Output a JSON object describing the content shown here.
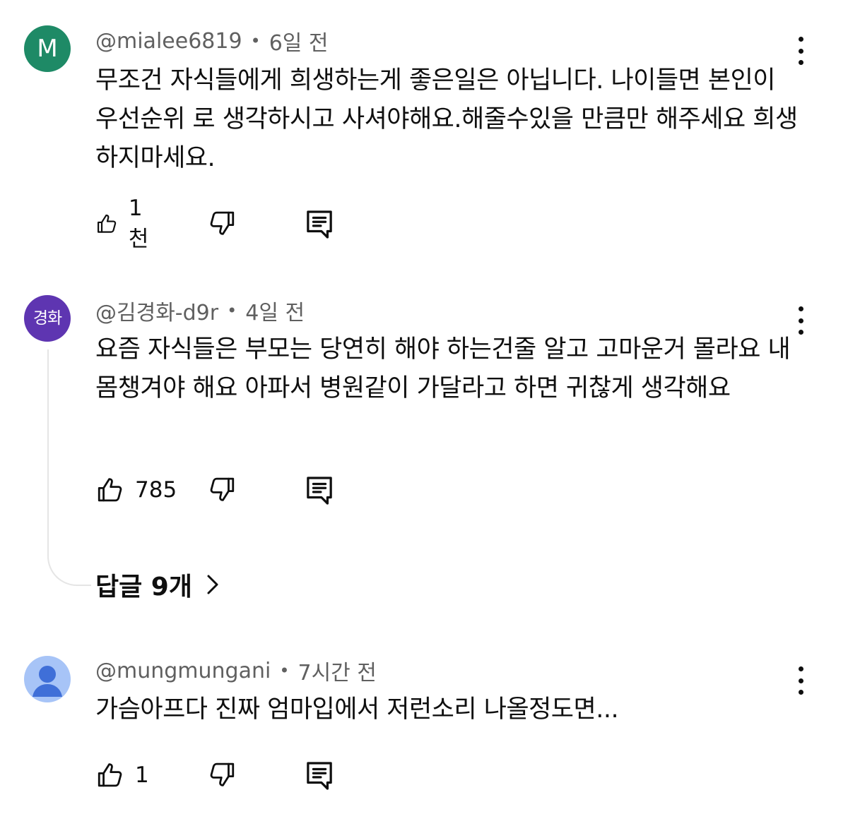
{
  "comments": [
    {
      "avatar": {
        "type": "letter",
        "text": "M",
        "color": "#1e8a66"
      },
      "handle": "@mialee6819",
      "time": "6일 전",
      "text": "무조건 자식들에게 희생하는게 좋은일은 아닙니다. 나이들면 본인이 우선순위 로 생각하시고 사셔야해요.해줄수있을 만큼만 해주세요 희생하지마세요.",
      "likes": "1천"
    },
    {
      "avatar": {
        "type": "text",
        "text": "경화",
        "color": "#5e35b1"
      },
      "handle": "@김경화-d9r",
      "time": "4일 전",
      "text": "요즘 자식들은 부모는 당연히 해야 하는건줄 알고 고마운거 몰라요 내몸챙겨야 해요 아파서 병원같이 가달라고 하면 귀찮게 생각해요",
      "likes": "785",
      "replies_label": "답글 9개"
    },
    {
      "avatar": {
        "type": "default",
        "color": "#a7c4f7"
      },
      "handle": "@mungmungani",
      "time": "7시간 전",
      "text": "가슴아프다 진짜 엄마입에서 저런소리 나올정도면...",
      "likes": "1"
    }
  ],
  "icons": {
    "like": "thumbs-up-icon",
    "dislike": "thumbs-down-icon",
    "reply": "reply-icon",
    "menu": "more-vert-icon",
    "chevron": "chevron-right-icon"
  }
}
